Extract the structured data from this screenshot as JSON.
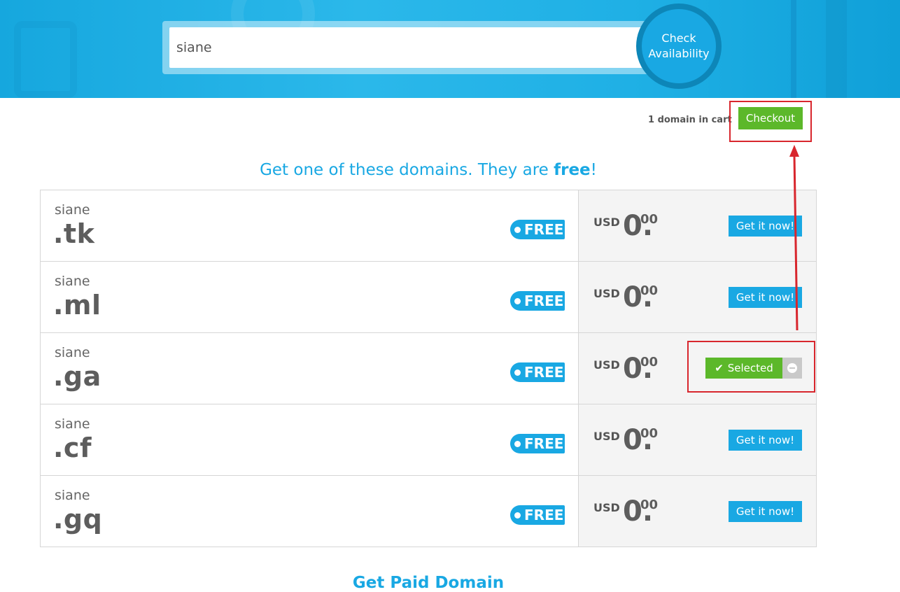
{
  "search": {
    "value": "siane"
  },
  "check_button": {
    "line1": "Check",
    "line2": "Availability"
  },
  "cart": {
    "count_text": "1 domain in cart",
    "checkout_label": "Checkout"
  },
  "heading": {
    "prefix": "Get one of these domains. They are ",
    "emphasis": "free",
    "suffix": "!"
  },
  "domains": [
    {
      "name": "siane",
      "tld": ".tk",
      "badge": "FREE",
      "currency": "USD",
      "price_int": "0.",
      "price_dec": "00",
      "action": "Get it now!"
    },
    {
      "name": "siane",
      "tld": ".ml",
      "badge": "FREE",
      "currency": "USD",
      "price_int": "0.",
      "price_dec": "00",
      "action": "Get it now!"
    },
    {
      "name": "siane",
      "tld": ".ga",
      "badge": "FREE",
      "currency": "USD",
      "price_int": "0.",
      "price_dec": "00",
      "action": "Selected"
    },
    {
      "name": "siane",
      "tld": ".cf",
      "badge": "FREE",
      "currency": "USD",
      "price_int": "0.",
      "price_dec": "00",
      "action": "Get it now!"
    },
    {
      "name": "siane",
      "tld": ".gq",
      "badge": "FREE",
      "currency": "USD",
      "price_int": "0.",
      "price_dec": "00",
      "action": "Get it now!"
    }
  ],
  "footer_heading": "Get Paid Domain",
  "colors": {
    "accent": "#19a8e3",
    "success": "#5cb82a",
    "annotation": "#d8262d"
  }
}
